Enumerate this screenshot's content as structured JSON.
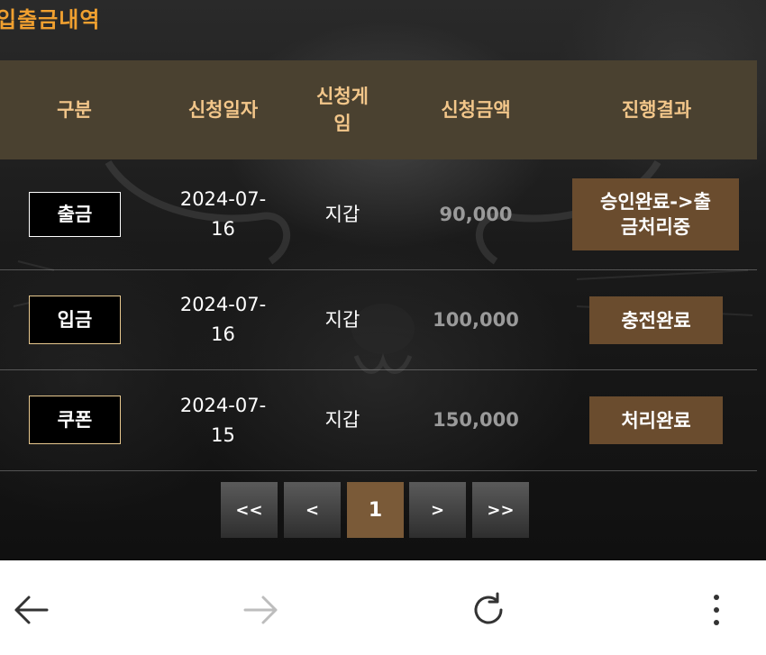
{
  "page": {
    "title": "입출금내역"
  },
  "table": {
    "headers": [
      "구분",
      "신청일자",
      "신청게\n임",
      "신청금액",
      "진행결과"
    ],
    "rows": [
      {
        "type": "출금",
        "date": "2024-07-\n16",
        "game": "지갑",
        "amount": "90,000",
        "status": "승인완료->출\n금처리중"
      },
      {
        "type": "입금",
        "date": "2024-07-\n16",
        "game": "지갑",
        "amount": "100,000",
        "status": "충전완료"
      },
      {
        "type": "쿠폰",
        "date": "2024-07-\n15",
        "game": "지갑",
        "amount": "150,000",
        "status": "처리완료"
      }
    ]
  },
  "pagination": {
    "first": "<<",
    "prev": "<",
    "current": "1",
    "next": ">",
    "last": ">>"
  },
  "browser": {
    "back_icon": "arrow-left-icon",
    "forward_icon": "arrow-right-icon",
    "reload_icon": "reload-icon",
    "menu_icon": "more-vertical-icon"
  },
  "colors": {
    "title": "#f0a030",
    "header_bg": "#4a4130",
    "header_text": "#f2c68a",
    "status_bg": "#6a4c2e",
    "pager_active": "#7a5a38"
  }
}
